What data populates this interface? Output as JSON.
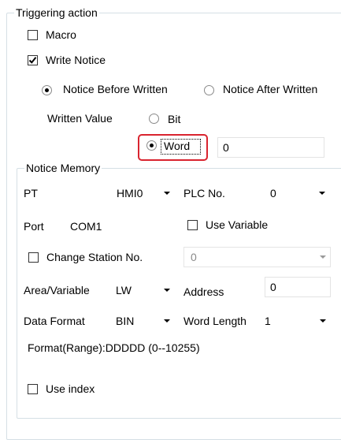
{
  "triggering": {
    "legend": "Triggering action",
    "macro_label": "Macro",
    "macro_checked": false,
    "write_notice_label": "Write Notice",
    "write_notice_checked": true,
    "notice_before_label": "Notice Before Written",
    "notice_before_selected": true,
    "notice_after_label": "Notice After Written",
    "notice_after_selected": false,
    "written_value_label": "Written Value",
    "bit_label": "Bit",
    "bit_selected": false,
    "word_label": "Word",
    "word_selected": true,
    "word_value": "0"
  },
  "notice_memory": {
    "legend": "Notice Memory",
    "pt_label": "PT",
    "pt_value": "HMI0",
    "plc_no_label": "PLC No.",
    "plc_no_value": "0",
    "port_label": "Port",
    "port_value": "COM1",
    "use_variable_label": "Use Variable",
    "use_variable_checked": false,
    "change_station_label": "Change Station No.",
    "change_station_checked": false,
    "station_value": "0",
    "area_label": "Area/Variable",
    "area_value": "LW",
    "address_label": "Address",
    "address_value": "0",
    "data_format_label": "Data Format",
    "data_format_value": "BIN",
    "word_length_label": "Word Length",
    "word_length_value": "1",
    "format_range_text": "Format(Range):DDDDD (0--10255)",
    "use_index_label": "Use index",
    "use_index_checked": false
  }
}
